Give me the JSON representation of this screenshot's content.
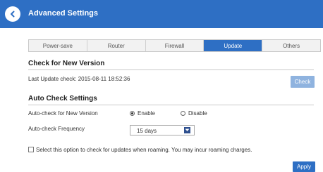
{
  "header": {
    "title": "Advanced Settings",
    "back_icon": "chevron-left-icon"
  },
  "tabs": [
    {
      "label": "Power-save",
      "active": false
    },
    {
      "label": "Router",
      "active": false
    },
    {
      "label": "Firewall",
      "active": false
    },
    {
      "label": "Update",
      "active": true
    },
    {
      "label": "Others",
      "active": false
    }
  ],
  "check_new_version": {
    "title": "Check for New Version",
    "last_update": "Last Update check: 2015-08-11 18:52:36",
    "check_label": "Check"
  },
  "auto_check": {
    "title": "Auto Check Settings",
    "auto_check_label": "Auto-check for New Version",
    "enable_label": "Enable",
    "disable_label": "Disable",
    "selected": "Enable",
    "frequency_label": "Auto-check Frequency",
    "frequency_value": "15 days",
    "roaming_label": "Select this option to check for updates when roaming. You may incur roaming charges.",
    "roaming_checked": false
  },
  "footer": {
    "apply_label": "Apply"
  },
  "colors": {
    "accent": "#2e6fc4",
    "check_disabled": "#8fb3df"
  }
}
